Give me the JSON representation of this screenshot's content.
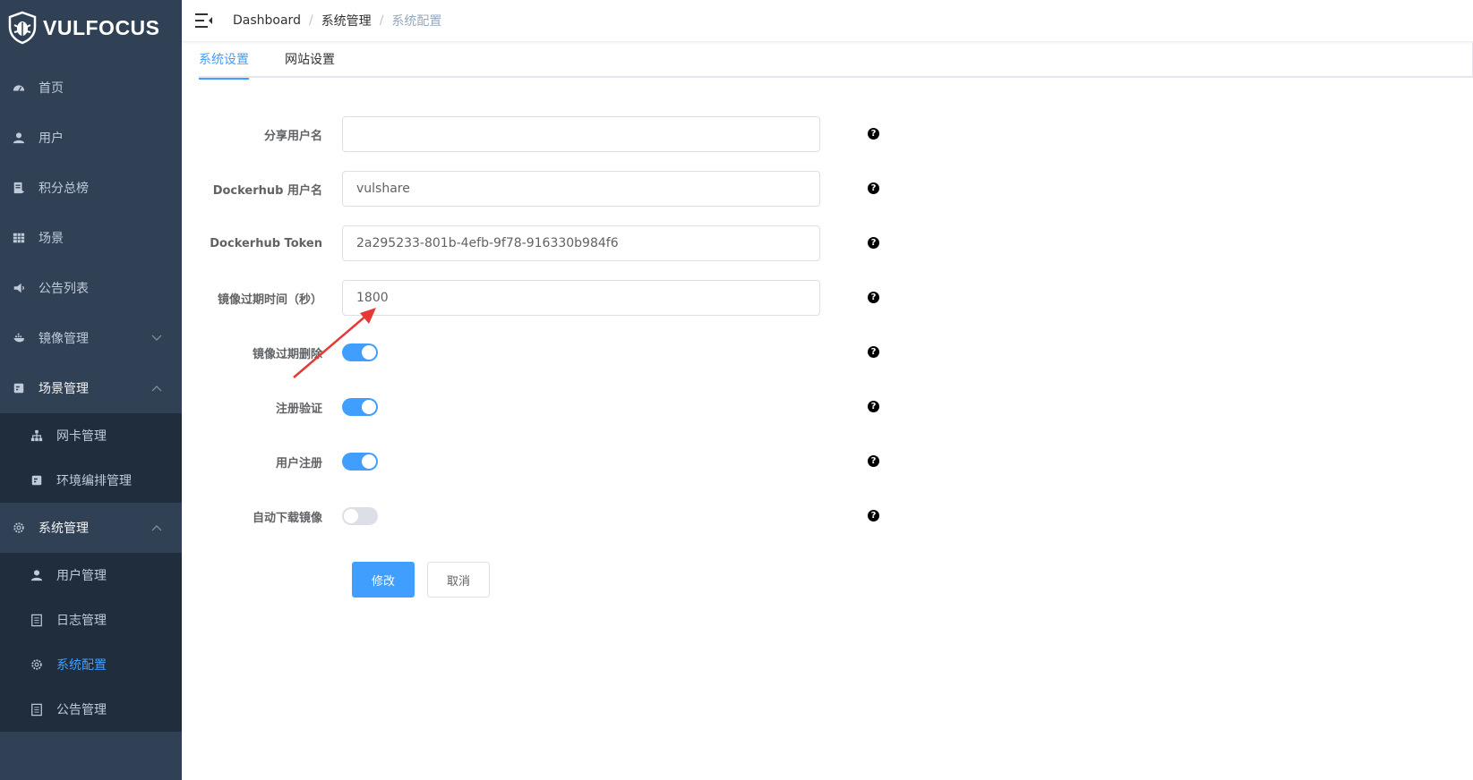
{
  "brand": {
    "name": "VULFOCUS"
  },
  "sidebar": {
    "items": [
      {
        "label": "首页",
        "icon": "dashboard-icon"
      },
      {
        "label": "用户",
        "icon": "user-icon"
      },
      {
        "label": "积分总榜",
        "icon": "document-icon"
      },
      {
        "label": "场景",
        "icon": "table-icon"
      },
      {
        "label": "公告列表",
        "icon": "megaphone-icon"
      },
      {
        "label": "镜像管理",
        "icon": "docker-icon"
      },
      {
        "label": "场景管理",
        "icon": "form-icon"
      }
    ],
    "scene_sub": [
      {
        "label": "网卡管理",
        "icon": "tree-icon"
      },
      {
        "label": "环境编排管理",
        "icon": "form-icon"
      }
    ],
    "system": {
      "label": "系统管理",
      "icon": "gear-icon"
    },
    "system_sub": [
      {
        "label": "用户管理",
        "icon": "user-icon"
      },
      {
        "label": "日志管理",
        "icon": "document-icon"
      },
      {
        "label": "系统配置",
        "icon": "gear-icon"
      },
      {
        "label": "公告管理",
        "icon": "document-icon"
      }
    ]
  },
  "breadcrumb": [
    "Dashboard",
    "系统管理",
    "系统配置"
  ],
  "tabs": [
    "系统设置",
    "网站设置"
  ],
  "form": {
    "share_username": {
      "label": "分享用户名",
      "value": ""
    },
    "dockerhub_username": {
      "label": "Dockerhub 用户名",
      "value": "vulshare"
    },
    "dockerhub_token": {
      "label": "Dockerhub Token",
      "value": "2a295233-801b-4efb-9f78-916330b984f6"
    },
    "image_expire_time": {
      "label": "镜像过期时间（秒）",
      "value": "1800"
    },
    "image_expire_delete": {
      "label": "镜像过期删除",
      "on": true
    },
    "register_verify": {
      "label": "注册验证",
      "on": true
    },
    "user_register": {
      "label": "用户注册",
      "on": true
    },
    "auto_download_image": {
      "label": "自动下载镜像",
      "on": false
    },
    "help_glyph": "?"
  },
  "buttons": {
    "submit": "修改",
    "cancel": "取消"
  },
  "colors": {
    "sidebar": "#304156",
    "submenu": "#1f2d3d",
    "accent": "#409eff",
    "annotation": "#e53935"
  }
}
